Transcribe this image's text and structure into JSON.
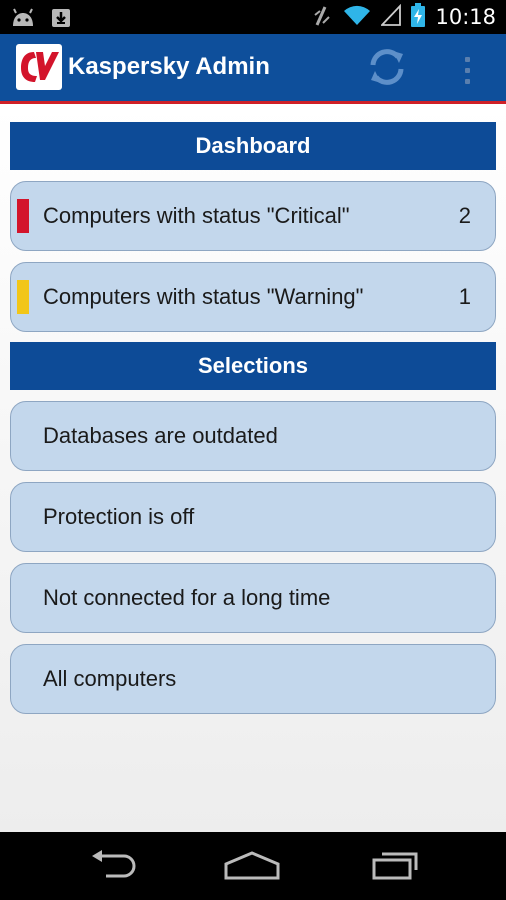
{
  "status_bar": {
    "time": "10:18",
    "icons": [
      "android-icon",
      "download-icon",
      "vibrate-icon",
      "wifi-icon",
      "signal-icon",
      "battery-charging-icon"
    ]
  },
  "action_bar": {
    "title": "Kaspersky Admin",
    "logo_icon": "kaspersky-logo-icon",
    "refresh_icon": "refresh-icon",
    "overflow_icon": "overflow-menu-icon"
  },
  "dashboard": {
    "header": "Dashboard",
    "items": [
      {
        "label": "Computers with status \"Critical\"",
        "count": "2",
        "indicator_color": "#d3142b"
      },
      {
        "label": "Computers with status \"Warning\"",
        "count": "1",
        "indicator_color": "#f2c618"
      }
    ]
  },
  "selections": {
    "header": "Selections",
    "items": [
      {
        "label": "Databases are outdated"
      },
      {
        "label": "Protection is off"
      },
      {
        "label": "Not connected for a long time"
      },
      {
        "label": "All computers"
      }
    ]
  },
  "nav_bar": {
    "icons": [
      "back-icon",
      "home-icon",
      "recent-apps-icon"
    ]
  },
  "colors": {
    "action_bar": "#0e4f9b",
    "accent_line": "#cf2027",
    "section_header": "#0d4b97",
    "row_background": "#c3d7ec"
  }
}
